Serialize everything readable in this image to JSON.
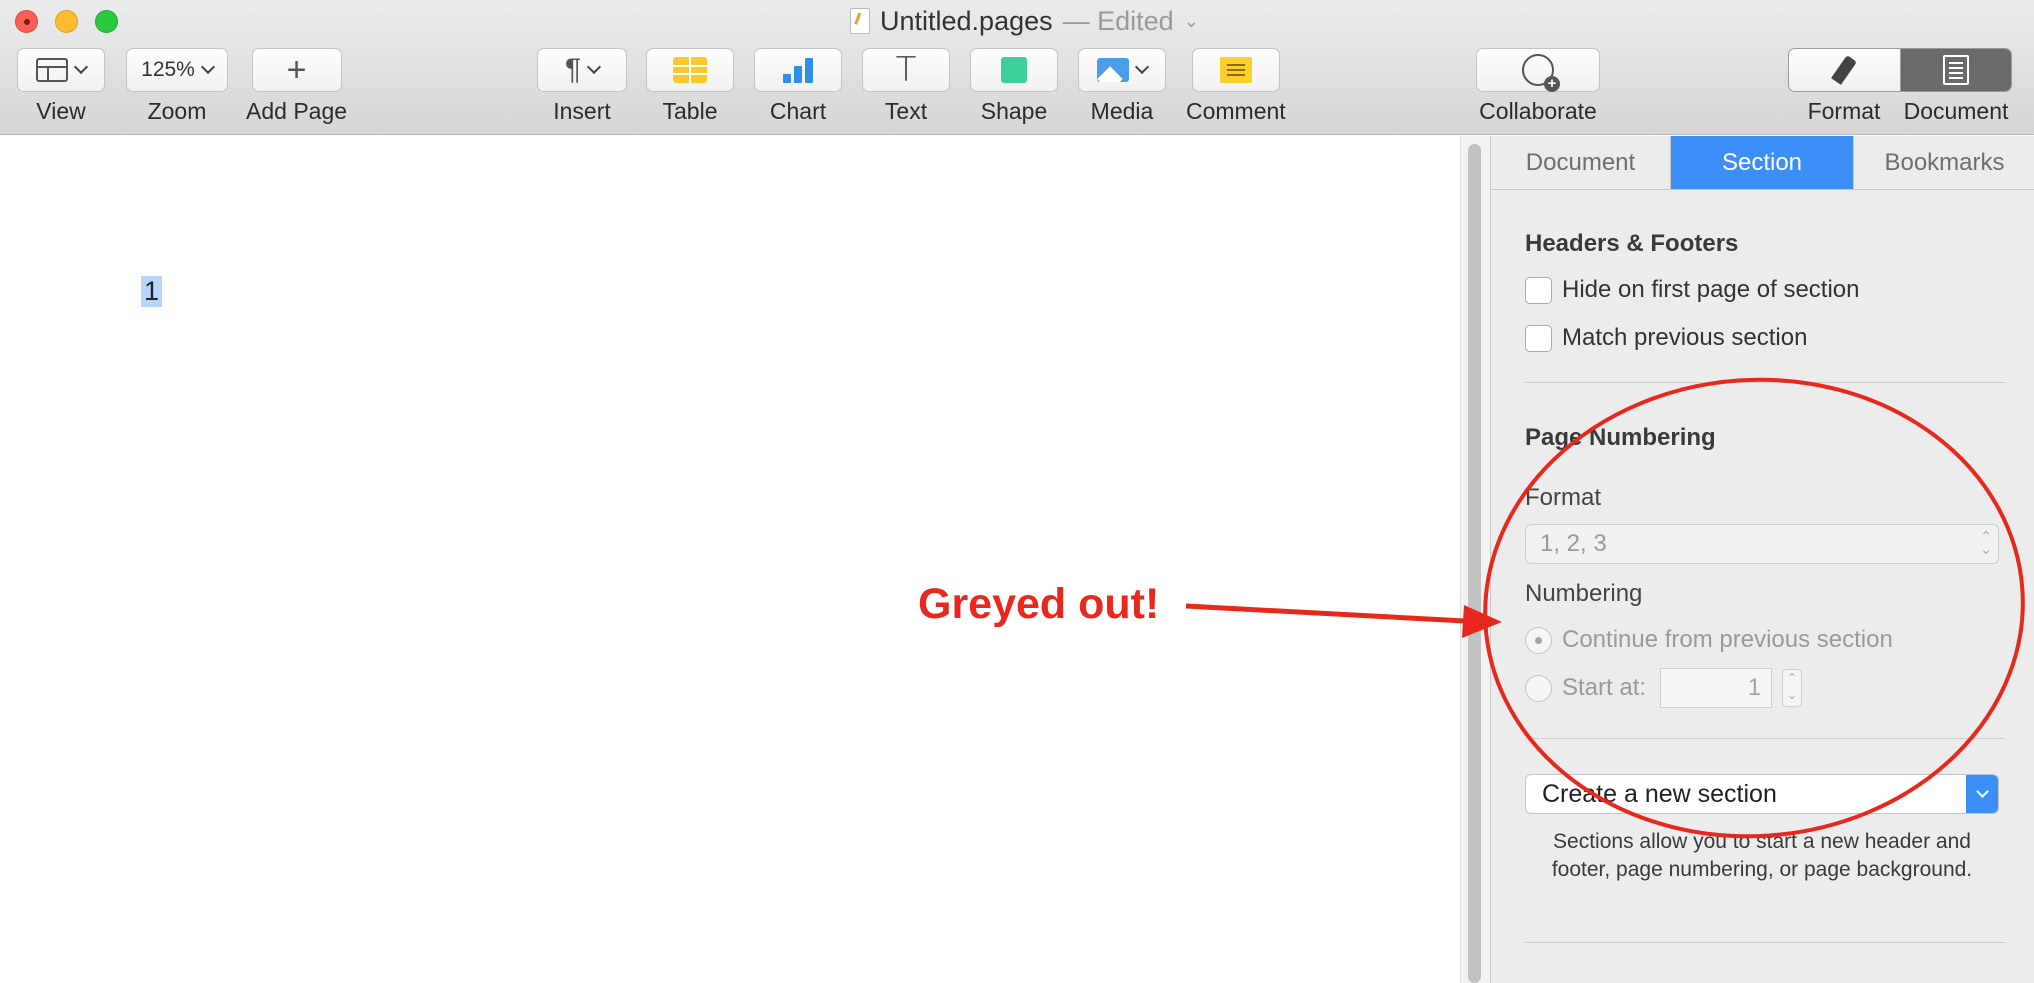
{
  "window": {
    "title": "Untitled.pages",
    "edited": "— Edited",
    "colors": {
      "close": "#fc5f57",
      "minimize": "#fdbc2e",
      "zoom": "#28c840"
    }
  },
  "toolbar": {
    "view_label": "View",
    "zoom_value": "125%",
    "zoom_label": "Zoom",
    "add_page_label": "Add Page",
    "insert_label": "Insert",
    "table_label": "Table",
    "chart_label": "Chart",
    "text_label": "Text",
    "shape_label": "Shape",
    "media_label": "Media",
    "comment_label": "Comment",
    "collaborate_label": "Collaborate",
    "format_label": "Format",
    "document_label": "Document"
  },
  "canvas": {
    "page_number": "1"
  },
  "inspector": {
    "tabs": [
      "Document",
      "Section",
      "Bookmarks"
    ],
    "active_tab": "Section",
    "accent": "#3b8ff7",
    "headers_footers": {
      "heading": "Headers & Footers",
      "hide_first_page": "Hide on first page of section",
      "match_previous": "Match previous section"
    },
    "page_numbering": {
      "heading": "Page Numbering",
      "format_label": "Format",
      "format_value": "1, 2, 3",
      "numbering_label": "Numbering",
      "continue_option": "Continue from previous section",
      "start_at_label": "Start at:",
      "start_at_value": "1"
    },
    "new_section_label": "Create a new section",
    "help_text": "Sections allow you to start a new header and footer, page numbering, or page background."
  },
  "annotation": {
    "text": "Greyed out!",
    "color": "#e8281c"
  }
}
